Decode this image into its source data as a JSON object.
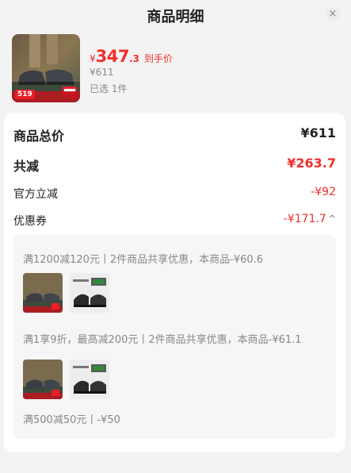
{
  "header": {
    "title": "商品明细",
    "close_icon": "×"
  },
  "product": {
    "price_symbol": "¥",
    "price_int": "347",
    "price_dec": ".3",
    "price_tag": "到手价",
    "original_price": "¥611",
    "selected_text": "已选 1件",
    "thumb_badge": "519"
  },
  "summary": {
    "total_label": "商品总价",
    "total_value": "¥611",
    "reduce_label": "共减",
    "reduce_value": "¥263.7",
    "official_label": "官方立减",
    "official_value": "-¥92",
    "coupon_label": "优惠券",
    "coupon_value": "-¥171.7",
    "coupon_caret": "^"
  },
  "coupons": [
    {
      "text": "满1200减120元丨2件商品共享优惠，本商品-¥60.6"
    },
    {
      "text": "满1享9折，最高减200元丨2件商品共享优惠，本商品-¥61.1"
    },
    {
      "text": "满500减50元丨-¥50"
    }
  ],
  "colors": {
    "accent_red": "#f0302d",
    "panel_bg": "#f6f6f6"
  }
}
